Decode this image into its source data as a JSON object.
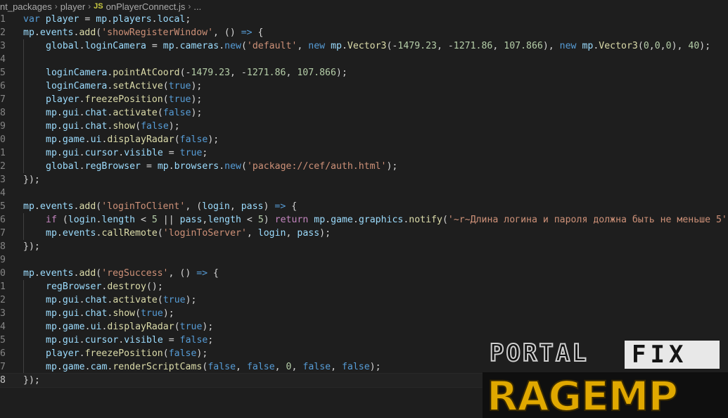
{
  "breadcrumb": {
    "items": [
      "nt_packages",
      "player"
    ],
    "file_badge": "JS",
    "file_name": "onPlayerConnect.js",
    "trailing": "..."
  },
  "watermark": {
    "line1_left": "PORTAL",
    "line1_right": "FIX",
    "line2": "RAGEMP"
  },
  "lines": [
    {
      "n": "1",
      "tokens": [
        [
          "kw",
          "var"
        ],
        [
          "pl",
          " "
        ],
        [
          "vr",
          "player"
        ],
        [
          "pl",
          " = "
        ],
        [
          "vr",
          "mp"
        ],
        [
          "pl",
          "."
        ],
        [
          "vr",
          "players"
        ],
        [
          "pl",
          "."
        ],
        [
          "vr",
          "local"
        ],
        [
          "pl",
          ";"
        ]
      ]
    },
    {
      "n": "2",
      "tokens": [
        [
          "vr",
          "mp"
        ],
        [
          "pl",
          "."
        ],
        [
          "vr",
          "events"
        ],
        [
          "pl",
          "."
        ],
        [
          "fn",
          "add"
        ],
        [
          "pl",
          "("
        ],
        [
          "st",
          "'showRegisterWindow'"
        ],
        [
          "pl",
          ", () "
        ],
        [
          "kw",
          "=>"
        ],
        [
          "pl",
          " {"
        ]
      ]
    },
    {
      "n": "3",
      "indent": 1,
      "tokens": [
        [
          "vr",
          "global"
        ],
        [
          "pl",
          "."
        ],
        [
          "vr",
          "loginCamera"
        ],
        [
          "pl",
          " = "
        ],
        [
          "vr",
          "mp"
        ],
        [
          "pl",
          "."
        ],
        [
          "vr",
          "cameras"
        ],
        [
          "pl",
          "."
        ],
        [
          "kw",
          "new"
        ],
        [
          "pl",
          "("
        ],
        [
          "st",
          "'default'"
        ],
        [
          "pl",
          ", "
        ],
        [
          "kw",
          "new"
        ],
        [
          "pl",
          " "
        ],
        [
          "vr",
          "mp"
        ],
        [
          "pl",
          "."
        ],
        [
          "fn",
          "Vector3"
        ],
        [
          "pl",
          "(-"
        ],
        [
          "nm",
          "1479.23"
        ],
        [
          "pl",
          ", -"
        ],
        [
          "nm",
          "1271.86"
        ],
        [
          "pl",
          ", "
        ],
        [
          "nm",
          "107.866"
        ],
        [
          "pl",
          "), "
        ],
        [
          "kw",
          "new"
        ],
        [
          "pl",
          " "
        ],
        [
          "vr",
          "mp"
        ],
        [
          "pl",
          "."
        ],
        [
          "fn",
          "Vector3"
        ],
        [
          "pl",
          "("
        ],
        [
          "nm",
          "0"
        ],
        [
          "pl",
          ","
        ],
        [
          "nm",
          "0"
        ],
        [
          "pl",
          ","
        ],
        [
          "nm",
          "0"
        ],
        [
          "pl",
          "), "
        ],
        [
          "nm",
          "40"
        ],
        [
          "pl",
          ");"
        ]
      ]
    },
    {
      "n": "4",
      "indent": 1,
      "tokens": []
    },
    {
      "n": "5",
      "indent": 1,
      "tokens": [
        [
          "vr",
          "loginCamera"
        ],
        [
          "pl",
          "."
        ],
        [
          "fn",
          "pointAtCoord"
        ],
        [
          "pl",
          "(-"
        ],
        [
          "nm",
          "1479.23"
        ],
        [
          "pl",
          ", -"
        ],
        [
          "nm",
          "1271.86"
        ],
        [
          "pl",
          ", "
        ],
        [
          "nm",
          "107.866"
        ],
        [
          "pl",
          ");"
        ]
      ]
    },
    {
      "n": "6",
      "indent": 1,
      "tokens": [
        [
          "vr",
          "loginCamera"
        ],
        [
          "pl",
          "."
        ],
        [
          "fn",
          "setActive"
        ],
        [
          "pl",
          "("
        ],
        [
          "kw",
          "true"
        ],
        [
          "pl",
          ");"
        ]
      ]
    },
    {
      "n": "7",
      "indent": 1,
      "tokens": [
        [
          "vr",
          "player"
        ],
        [
          "pl",
          "."
        ],
        [
          "fn",
          "freezePosition"
        ],
        [
          "pl",
          "("
        ],
        [
          "kw",
          "true"
        ],
        [
          "pl",
          ");"
        ]
      ]
    },
    {
      "n": "8",
      "indent": 1,
      "tokens": [
        [
          "vr",
          "mp"
        ],
        [
          "pl",
          "."
        ],
        [
          "vr",
          "gui"
        ],
        [
          "pl",
          "."
        ],
        [
          "vr",
          "chat"
        ],
        [
          "pl",
          "."
        ],
        [
          "fn",
          "activate"
        ],
        [
          "pl",
          "("
        ],
        [
          "kw",
          "false"
        ],
        [
          "pl",
          ");"
        ]
      ]
    },
    {
      "n": "9",
      "indent": 1,
      "tokens": [
        [
          "vr",
          "mp"
        ],
        [
          "pl",
          "."
        ],
        [
          "vr",
          "gui"
        ],
        [
          "pl",
          "."
        ],
        [
          "vr",
          "chat"
        ],
        [
          "pl",
          "."
        ],
        [
          "fn",
          "show"
        ],
        [
          "pl",
          "("
        ],
        [
          "kw",
          "false"
        ],
        [
          "pl",
          ");"
        ]
      ]
    },
    {
      "n": "0",
      "indent": 1,
      "tokens": [
        [
          "vr",
          "mp"
        ],
        [
          "pl",
          "."
        ],
        [
          "vr",
          "game"
        ],
        [
          "pl",
          "."
        ],
        [
          "vr",
          "ui"
        ],
        [
          "pl",
          "."
        ],
        [
          "fn",
          "displayRadar"
        ],
        [
          "pl",
          "("
        ],
        [
          "kw",
          "false"
        ],
        [
          "pl",
          ");"
        ]
      ]
    },
    {
      "n": "1",
      "indent": 1,
      "tokens": [
        [
          "vr",
          "mp"
        ],
        [
          "pl",
          "."
        ],
        [
          "vr",
          "gui"
        ],
        [
          "pl",
          "."
        ],
        [
          "vr",
          "cursor"
        ],
        [
          "pl",
          "."
        ],
        [
          "vr",
          "visible"
        ],
        [
          "pl",
          " = "
        ],
        [
          "kw",
          "true"
        ],
        [
          "pl",
          ";"
        ]
      ]
    },
    {
      "n": "2",
      "indent": 1,
      "tokens": [
        [
          "vr",
          "global"
        ],
        [
          "pl",
          "."
        ],
        [
          "vr",
          "regBrowser"
        ],
        [
          "pl",
          " = "
        ],
        [
          "vr",
          "mp"
        ],
        [
          "pl",
          "."
        ],
        [
          "vr",
          "browsers"
        ],
        [
          "pl",
          "."
        ],
        [
          "kw",
          "new"
        ],
        [
          "pl",
          "("
        ],
        [
          "st",
          "'package://cef/auth.html'"
        ],
        [
          "pl",
          ");"
        ]
      ]
    },
    {
      "n": "3",
      "tokens": [
        [
          "pl",
          "});"
        ]
      ]
    },
    {
      "n": "4",
      "tokens": []
    },
    {
      "n": "5",
      "tokens": [
        [
          "vr",
          "mp"
        ],
        [
          "pl",
          "."
        ],
        [
          "vr",
          "events"
        ],
        [
          "pl",
          "."
        ],
        [
          "fn",
          "add"
        ],
        [
          "pl",
          "("
        ],
        [
          "st",
          "'loginToClient'"
        ],
        [
          "pl",
          ", ("
        ],
        [
          "vr",
          "login"
        ],
        [
          "pl",
          ", "
        ],
        [
          "vr",
          "pass"
        ],
        [
          "pl",
          ") "
        ],
        [
          "kw",
          "=>"
        ],
        [
          "pl",
          " {"
        ]
      ]
    },
    {
      "n": "6",
      "indent": 1,
      "tokens": [
        [
          "ctl",
          "if"
        ],
        [
          "pl",
          " ("
        ],
        [
          "vr",
          "login"
        ],
        [
          "pl",
          "."
        ],
        [
          "vr",
          "length"
        ],
        [
          "pl",
          " < "
        ],
        [
          "nm",
          "5"
        ],
        [
          "pl",
          " || "
        ],
        [
          "vr",
          "pass"
        ],
        [
          "pl",
          ","
        ],
        [
          "vr",
          "length"
        ],
        [
          "pl",
          " < "
        ],
        [
          "nm",
          "5"
        ],
        [
          "pl",
          ") "
        ],
        [
          "ctl",
          "return"
        ],
        [
          "pl",
          " "
        ],
        [
          "vr",
          "mp"
        ],
        [
          "pl",
          "."
        ],
        [
          "vr",
          "game"
        ],
        [
          "pl",
          "."
        ],
        [
          "vr",
          "graphics"
        ],
        [
          "pl",
          "."
        ],
        [
          "fn",
          "notify"
        ],
        [
          "pl",
          "("
        ],
        [
          "st",
          "'~r~Длина логина и пароля должна быть не меньше 5'"
        ],
        [
          "pl",
          ");"
        ]
      ]
    },
    {
      "n": "7",
      "indent": 1,
      "tokens": [
        [
          "vr",
          "mp"
        ],
        [
          "pl",
          "."
        ],
        [
          "vr",
          "events"
        ],
        [
          "pl",
          "."
        ],
        [
          "fn",
          "callRemote"
        ],
        [
          "pl",
          "("
        ],
        [
          "st",
          "'loginToServer'"
        ],
        [
          "pl",
          ", "
        ],
        [
          "vr",
          "login"
        ],
        [
          "pl",
          ", "
        ],
        [
          "vr",
          "pass"
        ],
        [
          "pl",
          ");"
        ]
      ]
    },
    {
      "n": "8",
      "tokens": [
        [
          "pl",
          "});"
        ]
      ]
    },
    {
      "n": "9",
      "tokens": []
    },
    {
      "n": "0",
      "tokens": [
        [
          "vr",
          "mp"
        ],
        [
          "pl",
          "."
        ],
        [
          "vr",
          "events"
        ],
        [
          "pl",
          "."
        ],
        [
          "fn",
          "add"
        ],
        [
          "pl",
          "("
        ],
        [
          "st",
          "'regSuccess'"
        ],
        [
          "pl",
          ", () "
        ],
        [
          "kw",
          "=>"
        ],
        [
          "pl",
          " {"
        ]
      ]
    },
    {
      "n": "1",
      "indent": 1,
      "tokens": [
        [
          "vr",
          "regBrowser"
        ],
        [
          "pl",
          "."
        ],
        [
          "fn",
          "destroy"
        ],
        [
          "pl",
          "();"
        ]
      ]
    },
    {
      "n": "2",
      "indent": 1,
      "tokens": [
        [
          "vr",
          "mp"
        ],
        [
          "pl",
          "."
        ],
        [
          "vr",
          "gui"
        ],
        [
          "pl",
          "."
        ],
        [
          "vr",
          "chat"
        ],
        [
          "pl",
          "."
        ],
        [
          "fn",
          "activate"
        ],
        [
          "pl",
          "("
        ],
        [
          "kw",
          "true"
        ],
        [
          "pl",
          ");"
        ]
      ]
    },
    {
      "n": "3",
      "indent": 1,
      "tokens": [
        [
          "vr",
          "mp"
        ],
        [
          "pl",
          "."
        ],
        [
          "vr",
          "gui"
        ],
        [
          "pl",
          "."
        ],
        [
          "vr",
          "chat"
        ],
        [
          "pl",
          "."
        ],
        [
          "fn",
          "show"
        ],
        [
          "pl",
          "("
        ],
        [
          "kw",
          "true"
        ],
        [
          "pl",
          ");"
        ]
      ]
    },
    {
      "n": "4",
      "indent": 1,
      "tokens": [
        [
          "vr",
          "mp"
        ],
        [
          "pl",
          "."
        ],
        [
          "vr",
          "game"
        ],
        [
          "pl",
          "."
        ],
        [
          "vr",
          "ui"
        ],
        [
          "pl",
          "."
        ],
        [
          "fn",
          "displayRadar"
        ],
        [
          "pl",
          "("
        ],
        [
          "kw",
          "true"
        ],
        [
          "pl",
          ");"
        ]
      ]
    },
    {
      "n": "5",
      "indent": 1,
      "tokens": [
        [
          "vr",
          "mp"
        ],
        [
          "pl",
          "."
        ],
        [
          "vr",
          "gui"
        ],
        [
          "pl",
          "."
        ],
        [
          "vr",
          "cursor"
        ],
        [
          "pl",
          "."
        ],
        [
          "vr",
          "visible"
        ],
        [
          "pl",
          " = "
        ],
        [
          "kw",
          "false"
        ],
        [
          "pl",
          ";"
        ]
      ]
    },
    {
      "n": "6",
      "indent": 1,
      "tokens": [
        [
          "vr",
          "player"
        ],
        [
          "pl",
          "."
        ],
        [
          "fn",
          "freezePosition"
        ],
        [
          "pl",
          "("
        ],
        [
          "kw",
          "false"
        ],
        [
          "pl",
          ");"
        ]
      ]
    },
    {
      "n": "7",
      "indent": 1,
      "tokens": [
        [
          "vr",
          "mp"
        ],
        [
          "pl",
          "."
        ],
        [
          "vr",
          "game"
        ],
        [
          "pl",
          "."
        ],
        [
          "vr",
          "cam"
        ],
        [
          "pl",
          "."
        ],
        [
          "fn",
          "renderScriptCams"
        ],
        [
          "pl",
          "("
        ],
        [
          "kw",
          "false"
        ],
        [
          "pl",
          ", "
        ],
        [
          "kw",
          "false"
        ],
        [
          "pl",
          ", "
        ],
        [
          "nm",
          "0"
        ],
        [
          "pl",
          ", "
        ],
        [
          "kw",
          "false"
        ],
        [
          "pl",
          ", "
        ],
        [
          "kw",
          "false"
        ],
        [
          "pl",
          ");"
        ]
      ]
    },
    {
      "n": "8",
      "current": true,
      "tokens": [
        [
          "pl",
          "});"
        ]
      ]
    }
  ]
}
